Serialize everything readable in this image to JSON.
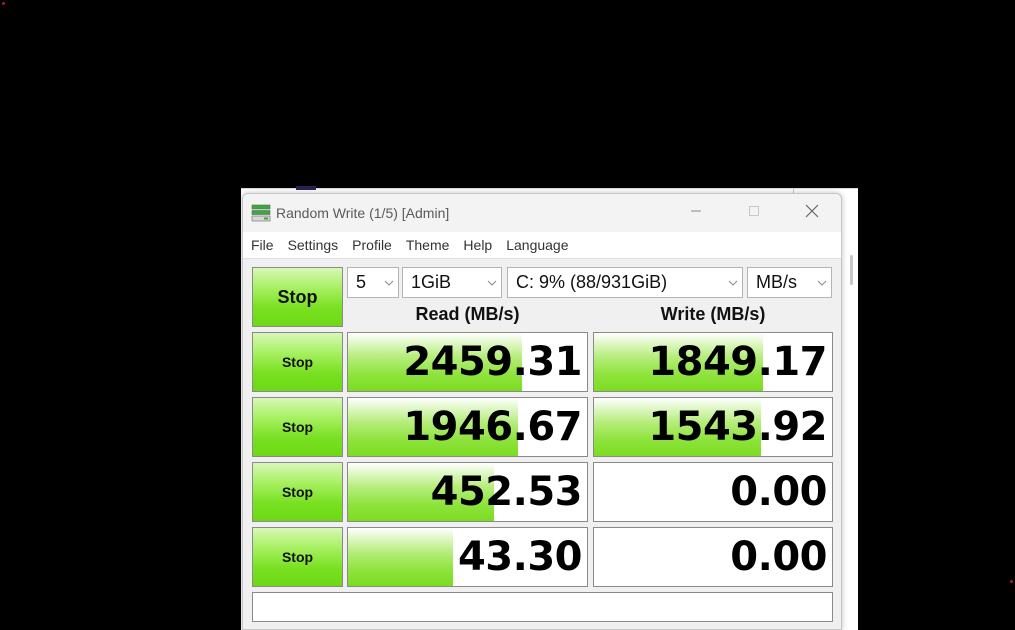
{
  "window": {
    "title": "Random Write (1/5) [Admin]",
    "icons": {
      "app": "disk-icon",
      "minimize": "minimize-icon",
      "maximize": "maximize-icon",
      "close": "close-icon"
    }
  },
  "menu": [
    "File",
    "Settings",
    "Profile",
    "Theme",
    "Help",
    "Language"
  ],
  "controls": {
    "all_button": "Stop",
    "count": "5",
    "size": "1GiB",
    "drive": "C: 9% (88/931GiB)",
    "unit": "MB/s"
  },
  "headers": {
    "read": "Read (MB/s)",
    "write": "Write (MB/s)"
  },
  "rows": [
    {
      "button": "Stop",
      "read": "2459.31",
      "read_fill": 0.73,
      "write": "1849.17",
      "write_fill": 0.71
    },
    {
      "button": "Stop",
      "read": "1946.67",
      "read_fill": 0.71,
      "write": "1543.92",
      "write_fill": 0.7
    },
    {
      "button": "Stop",
      "read": "452.53",
      "read_fill": 0.61,
      "write": "0.00",
      "write_fill": 0
    },
    {
      "button": "Stop",
      "read": "43.30",
      "read_fill": 0.44,
      "write": "0.00",
      "write_fill": 0
    }
  ],
  "comment": "",
  "colors": {
    "accent_green": "#7cdc22",
    "background": "#000000"
  }
}
